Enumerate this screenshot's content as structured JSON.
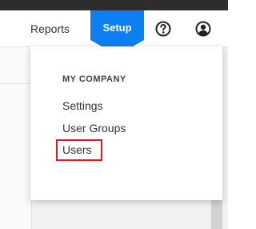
{
  "nav": {
    "reports_label": "Reports",
    "setup_label": "Setup",
    "help_icon": "question-circle-icon",
    "account_icon": "user-circle-icon"
  },
  "dropdown": {
    "heading": "MY COMPANY",
    "items": [
      {
        "label": "Settings"
      },
      {
        "label": "User Groups"
      },
      {
        "label": "Users"
      }
    ]
  },
  "colors": {
    "accent": "#0c7ff2",
    "highlight": "#e3161c",
    "top_strip": "#2d2d2d"
  }
}
